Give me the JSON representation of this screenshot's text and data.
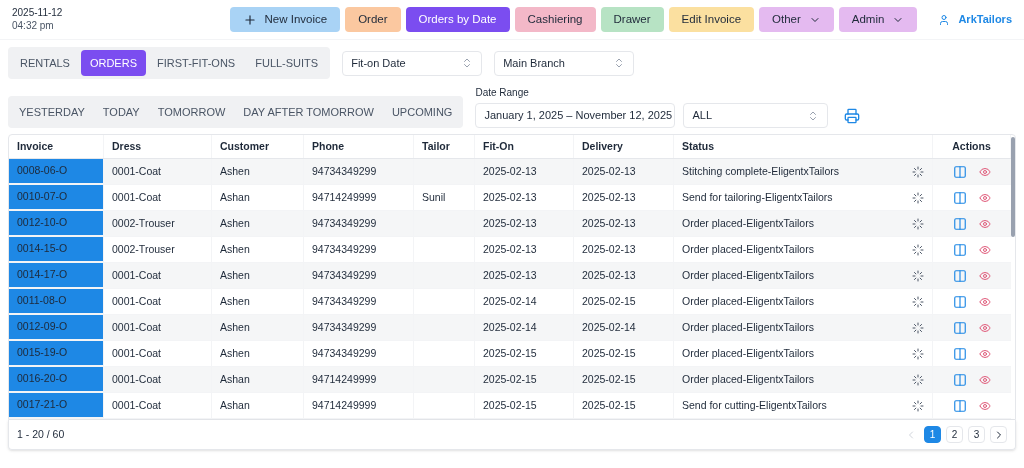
{
  "clock": {
    "date": "2025-11-12",
    "time": "04:32 pm"
  },
  "nav": [
    {
      "label": "New Invoice",
      "color": "#a9d3f5",
      "selected": false,
      "kind": "add"
    },
    {
      "label": "Order",
      "color": "#fbc8a0",
      "selected": false,
      "kind": "plain"
    },
    {
      "label": "Orders by Date",
      "color": "#7b4df0",
      "selected": true,
      "kind": "plain"
    },
    {
      "label": "Cashiering",
      "color": "#f3b8c8",
      "selected": false,
      "kind": "plain"
    },
    {
      "label": "Drawer",
      "color": "#b7e3c4",
      "selected": false,
      "kind": "plain"
    },
    {
      "label": "Edit Invoice",
      "color": "#fbe0a0",
      "selected": false,
      "kind": "plain"
    },
    {
      "label": "Other",
      "color": "#e4baf0",
      "selected": false,
      "kind": "dropdown"
    },
    {
      "label": "Admin",
      "color": "#e4baf0",
      "selected": false,
      "kind": "dropdown"
    }
  ],
  "user": "ArkTailors",
  "type_tabs": [
    {
      "label": "RENTALS",
      "selected": false
    },
    {
      "label": "ORDERS",
      "selected": true
    },
    {
      "label": "FIRST-FIT-ONS",
      "selected": false
    },
    {
      "label": "FULL-SUITS",
      "selected": false
    }
  ],
  "date_field_select": "Fit-on Date",
  "branch_select": "Main Branch",
  "day_tabs": [
    {
      "label": "YESTERDAY",
      "selected": false
    },
    {
      "label": "TODAY",
      "selected": false
    },
    {
      "label": "TOMORROW",
      "selected": false
    },
    {
      "label": "DAY AFTER TOMORROW",
      "selected": false
    },
    {
      "label": "UPCOMING",
      "selected": false
    }
  ],
  "date_range": {
    "label": "Date Range",
    "value": "January 1, 2025 – November 12, 2025"
  },
  "status_select": "ALL",
  "table": {
    "columns": [
      "Invoice",
      "Dress",
      "Customer",
      "Phone",
      "Tailor",
      "Fit-On",
      "Delivery",
      "Status",
      "Actions"
    ],
    "rows": [
      [
        "0008-06-O",
        "0001-Coat",
        "Ashen",
        "94734349299",
        "",
        "2025-02-13",
        "2025-02-13",
        "Stitching complete-EligentxTailors"
      ],
      [
        "0010-07-O",
        "0001-Coat",
        "Ashan",
        "94714249999",
        "Sunil",
        "2025-02-13",
        "2025-02-13",
        "Send for tailoring-EligentxTailors"
      ],
      [
        "0012-10-O",
        "0002-Trouser",
        "Ashen",
        "94734349299",
        "",
        "2025-02-13",
        "2025-02-13",
        "Order placed-EligentxTailors"
      ],
      [
        "0014-15-O",
        "0002-Trouser",
        "Ashen",
        "94734349299",
        "",
        "2025-02-13",
        "2025-02-13",
        "Order placed-EligentxTailors"
      ],
      [
        "0014-17-O",
        "0001-Coat",
        "Ashen",
        "94734349299",
        "",
        "2025-02-13",
        "2025-02-13",
        "Order placed-EligentxTailors"
      ],
      [
        "0011-08-O",
        "0001-Coat",
        "Ashen",
        "94734349299",
        "",
        "2025-02-14",
        "2025-02-15",
        "Order placed-EligentxTailors"
      ],
      [
        "0012-09-O",
        "0001-Coat",
        "Ashen",
        "94734349299",
        "",
        "2025-02-14",
        "2025-02-14",
        "Order placed-EligentxTailors"
      ],
      [
        "0015-19-O",
        "0001-Coat",
        "Ashen",
        "94734349299",
        "",
        "2025-02-15",
        "2025-02-15",
        "Order placed-EligentxTailors"
      ],
      [
        "0016-20-O",
        "0001-Coat",
        "Ashan",
        "94714249999",
        "",
        "2025-02-15",
        "2025-02-15",
        "Order placed-EligentxTailors"
      ],
      [
        "0017-21-O",
        "0001-Coat",
        "Ashan",
        "94714249999",
        "",
        "2025-02-15",
        "2025-02-15",
        "Send for cutting-EligentxTailors"
      ]
    ]
  },
  "footer": {
    "count": "1 - 20 / 60",
    "pages": [
      {
        "label": "1",
        "selected": true
      },
      {
        "label": "2",
        "selected": false
      },
      {
        "label": "3",
        "selected": false
      }
    ]
  }
}
